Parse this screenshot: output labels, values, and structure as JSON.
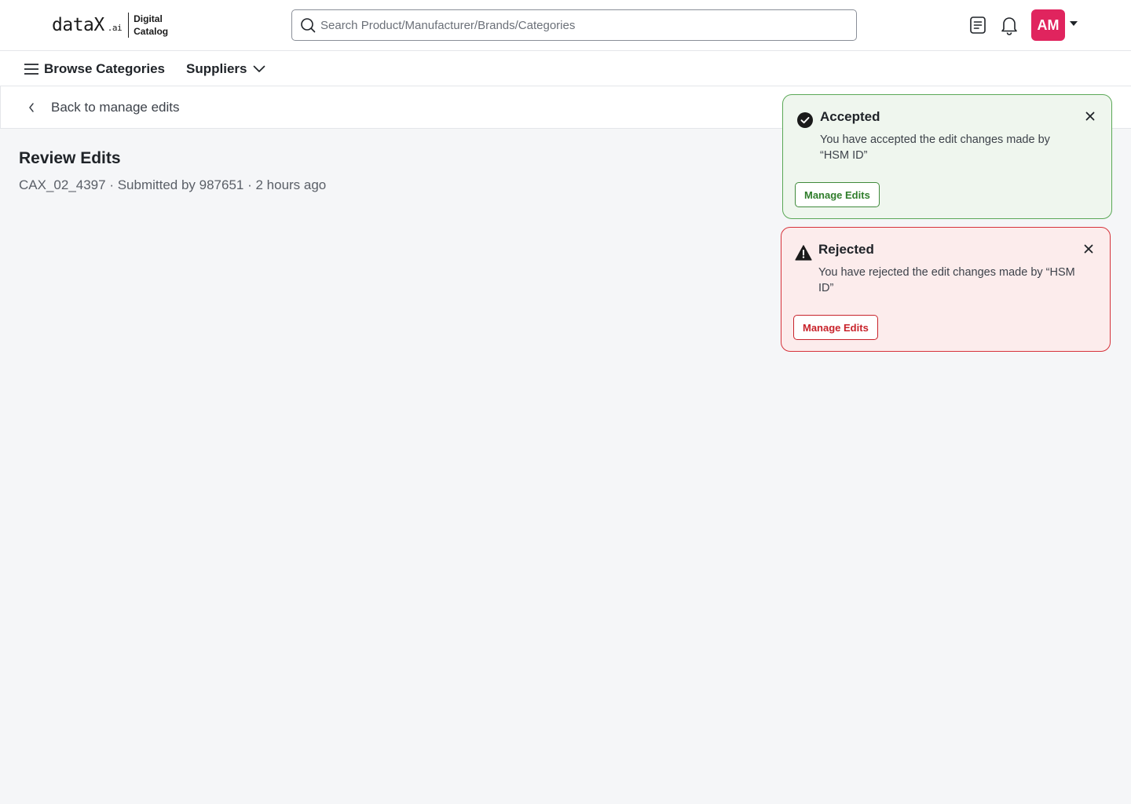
{
  "brand": {
    "wordmark": "dataX",
    "suffix": ".ai",
    "tagline_line1": "Digital",
    "tagline_line2": "Catalog"
  },
  "header": {
    "search_placeholder": "Search Product/Manufacturer/Brands/Categories",
    "search_value": "",
    "icons": [
      "document-icon",
      "bell-icon"
    ],
    "avatar_initials": "AM",
    "avatar_color": "#e0245e"
  },
  "nav": {
    "browse_label": "Browse Categories",
    "suppliers_label": "Suppliers"
  },
  "back": {
    "label": "Back to manage edits"
  },
  "review": {
    "title": "Review Edits",
    "meta": "CAX_02_4397 · Submitted by 987651 · 2 hours ago"
  },
  "toasts": {
    "accepted": {
      "title": "Accepted",
      "message": "You have accepted the edit changes made by “HSM ID”",
      "button": "Manage Edits",
      "accent": "#2f7d2b"
    },
    "rejected": {
      "title": "Rejected",
      "message": "You have rejected the edit changes made by “HSM ID”",
      "button": "Manage Edits",
      "accent": "#c8232b"
    }
  }
}
